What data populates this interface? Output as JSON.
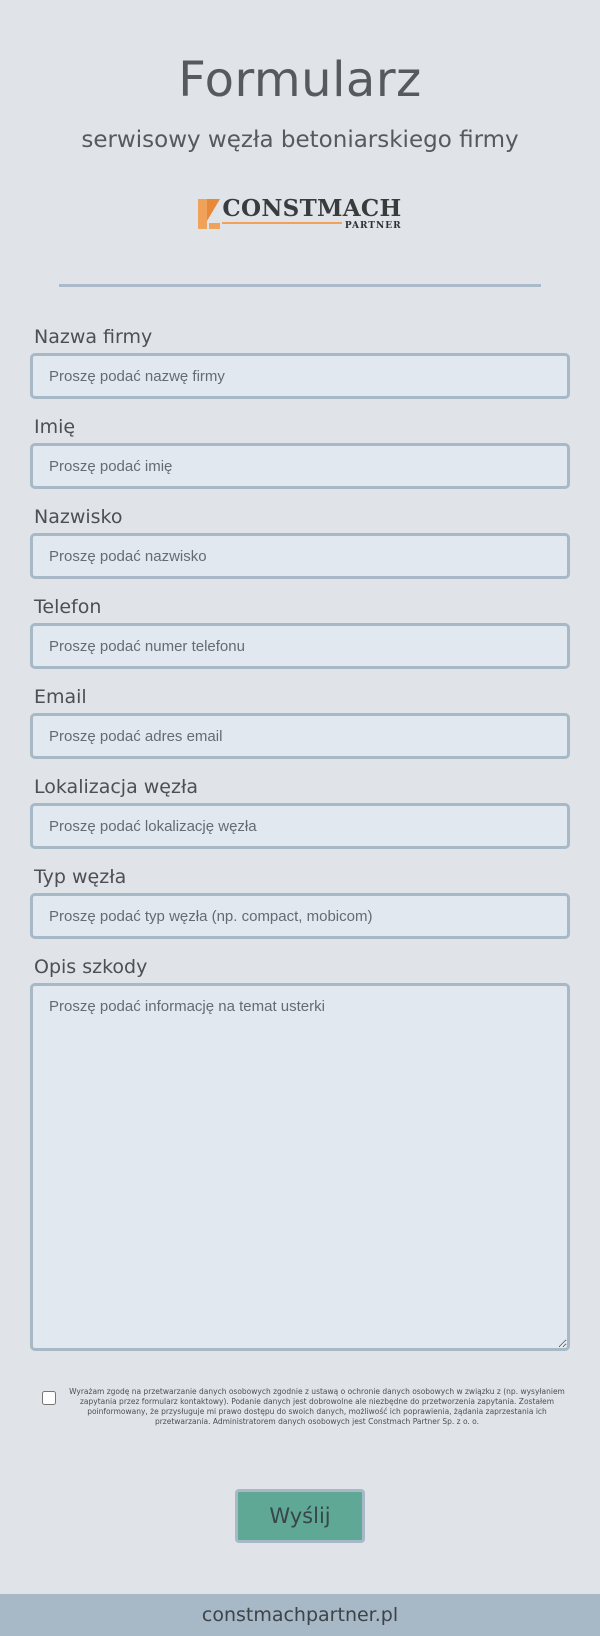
{
  "header": {
    "title": "Formularz",
    "subtitle": "serwisowy węzła betoniarskiego firmy",
    "logo": {
      "word": "CONSTMACH",
      "partner": "PARTNER",
      "accent_color": "#f0a15a"
    }
  },
  "form": {
    "fields": [
      {
        "label": "Nazwa firmy",
        "placeholder": "Proszę podać nazwę firmy",
        "value": ""
      },
      {
        "label": "Imię",
        "placeholder": "Proszę podać imię",
        "value": ""
      },
      {
        "label": "Nazwisko",
        "placeholder": "Proszę podać nazwisko",
        "value": ""
      },
      {
        "label": "Telefon",
        "placeholder": "Proszę podać numer telefonu",
        "value": ""
      },
      {
        "label": "Email",
        "placeholder": "Proszę podać adres email",
        "value": ""
      },
      {
        "label": "Lokalizacja węzła",
        "placeholder": "Proszę podać lokalizację węzła",
        "value": ""
      },
      {
        "label": "Typ węzła",
        "placeholder": "Proszę podać typ węzła (np. compact, mobicom)",
        "value": ""
      }
    ],
    "description": {
      "label": "Opis szkody",
      "placeholder": "Proszę podać informację na temat usterki",
      "value": ""
    },
    "consent": {
      "checked": false,
      "text": "Wyrażam zgodę na przetwarzanie danych osobowych zgodnie z ustawą o ochronie danych osobowych w związku z (np. wysyłaniem zapytania przez formularz kontaktowy). Podanie danych jest dobrowolne ale niezbędne do przetworzenia zapytania. Zostałem poinformowany, że przysługuje mi prawo dostępu do swoich danych, możliwość ich poprawienia, żądania zaprzestania ich przetwarzania. Administratorem danych osobowych jest Constmach Partner Sp. z o. o."
    },
    "submit_label": "Wyślij"
  },
  "footer": {
    "text": "constmachpartner.pl"
  },
  "colors": {
    "background": "#e0e4e9",
    "input_border": "#a7b8c6",
    "submit": "#5ea895"
  }
}
